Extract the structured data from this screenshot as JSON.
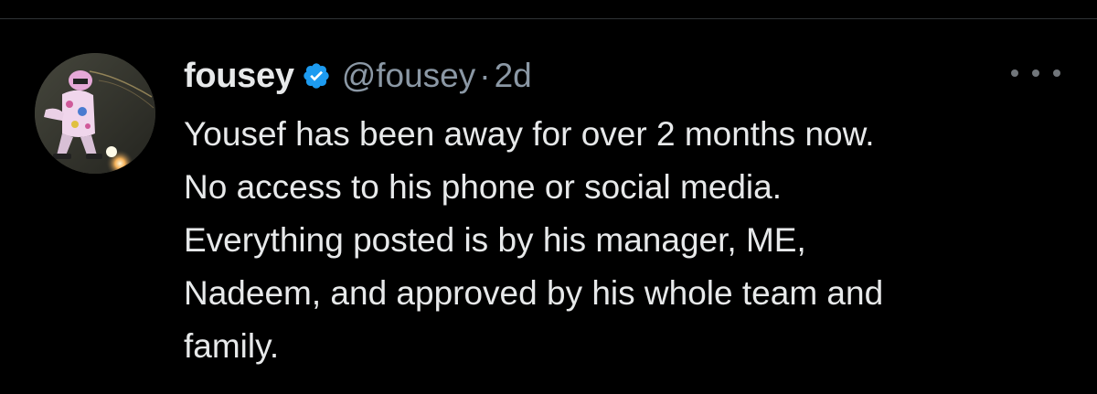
{
  "tweet": {
    "display_name": "fousey",
    "handle": "@fousey",
    "separator": "·",
    "time": "2d",
    "verified": true,
    "verified_color": "#1d9bf0",
    "more_icon": "ellipsis-icon",
    "body_lines": [
      "Yousef has been away for over 2 months now.",
      "No access to his phone or social media.",
      "Everything posted is by his manager, ME,",
      "Nadeem, and approved by his whole team and",
      "family."
    ]
  },
  "colors": {
    "background": "#000000",
    "text_primary": "#e7e9ea",
    "text_secondary": "#8b98a5",
    "divider": "#2f3336"
  }
}
